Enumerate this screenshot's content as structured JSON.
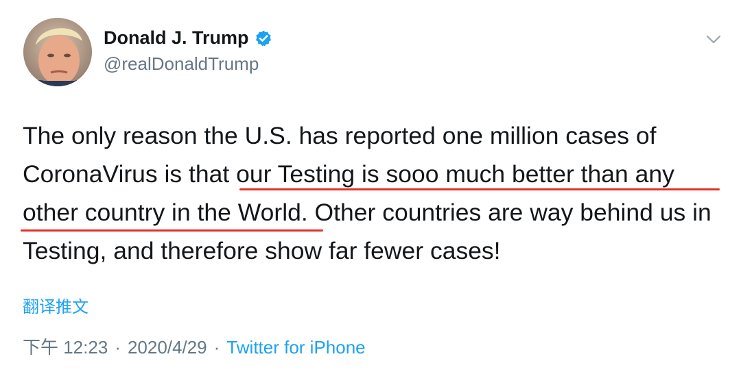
{
  "author": {
    "display_name": "Donald J. Trump",
    "handle": "@realDonaldTrump",
    "verified": true,
    "verified_color": "#1da1f2"
  },
  "tweet": {
    "text": "The only reason the U.S. has reported one million cases of CoronaVirus is that our Testing is sooo much better than any other country in the World. Other countries are way behind us in Testing, and therefore show far fewer cases!",
    "underline_color": "#e53021"
  },
  "translate_label": "翻译推文",
  "meta": {
    "time": "下午 12:23",
    "date": "2020/4/29",
    "separator": "·",
    "source": "Twitter for iPhone"
  },
  "icons": {
    "avatar": "profile-photo",
    "verified": "verified-badge-icon",
    "caret": "chevron-down-icon"
  },
  "colors": {
    "text": "#14171a",
    "secondary": "#657786",
    "link": "#1da1f2"
  }
}
